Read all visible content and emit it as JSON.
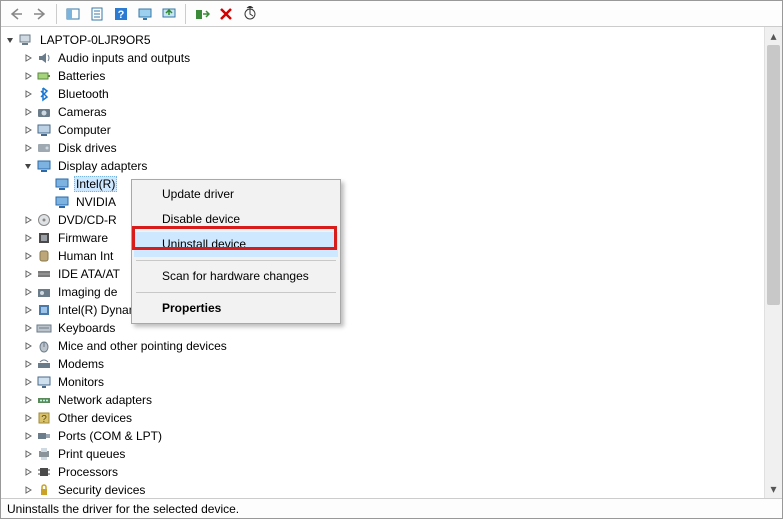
{
  "toolbar": {
    "back": "Back",
    "forward": "Forward",
    "show_hide": "Show/Hide Console Tree",
    "properties": "Properties",
    "help": "Help",
    "action": "Action",
    "update": "Update",
    "enable": "Enable",
    "uninstall": "Uninstall",
    "scan": "Scan"
  },
  "tree": {
    "root": "LAPTOP-0LJR9OR5",
    "items": [
      {
        "label": "Audio inputs and outputs",
        "icon": "audio"
      },
      {
        "label": "Batteries",
        "icon": "battery"
      },
      {
        "label": "Bluetooth",
        "icon": "bluetooth"
      },
      {
        "label": "Cameras",
        "icon": "camera"
      },
      {
        "label": "Computer",
        "icon": "computer"
      },
      {
        "label": "Disk drives",
        "icon": "disk"
      },
      {
        "label": "Display adapters",
        "icon": "display",
        "expanded": true,
        "children": [
          {
            "label": "Intel(R)",
            "icon": "display",
            "selected": true
          },
          {
            "label": "NVIDIA",
            "icon": "display"
          }
        ]
      },
      {
        "label": "DVD/CD-R",
        "icon": "dvd"
      },
      {
        "label": "Firmware",
        "icon": "firmware"
      },
      {
        "label": "Human Int",
        "icon": "hid"
      },
      {
        "label": "IDE ATA/AT",
        "icon": "ide"
      },
      {
        "label": "Imaging de",
        "icon": "imaging"
      },
      {
        "label": "Intel(R) Dynamic Platform and Thermal Framework",
        "icon": "intel"
      },
      {
        "label": "Keyboards",
        "icon": "keyboard"
      },
      {
        "label": "Mice and other pointing devices",
        "icon": "mouse"
      },
      {
        "label": "Modems",
        "icon": "modem"
      },
      {
        "label": "Monitors",
        "icon": "monitor"
      },
      {
        "label": "Network adapters",
        "icon": "network"
      },
      {
        "label": "Other devices",
        "icon": "other"
      },
      {
        "label": "Ports (COM & LPT)",
        "icon": "port"
      },
      {
        "label": "Print queues",
        "icon": "printer"
      },
      {
        "label": "Processors",
        "icon": "cpu"
      },
      {
        "label": "Security devices",
        "icon": "security"
      }
    ]
  },
  "context_menu": {
    "update_driver": "Update driver",
    "disable_device": "Disable device",
    "uninstall_device": "Uninstall device",
    "scan_hw": "Scan for hardware changes",
    "properties": "Properties"
  },
  "status": "Uninstalls the driver for the selected device."
}
